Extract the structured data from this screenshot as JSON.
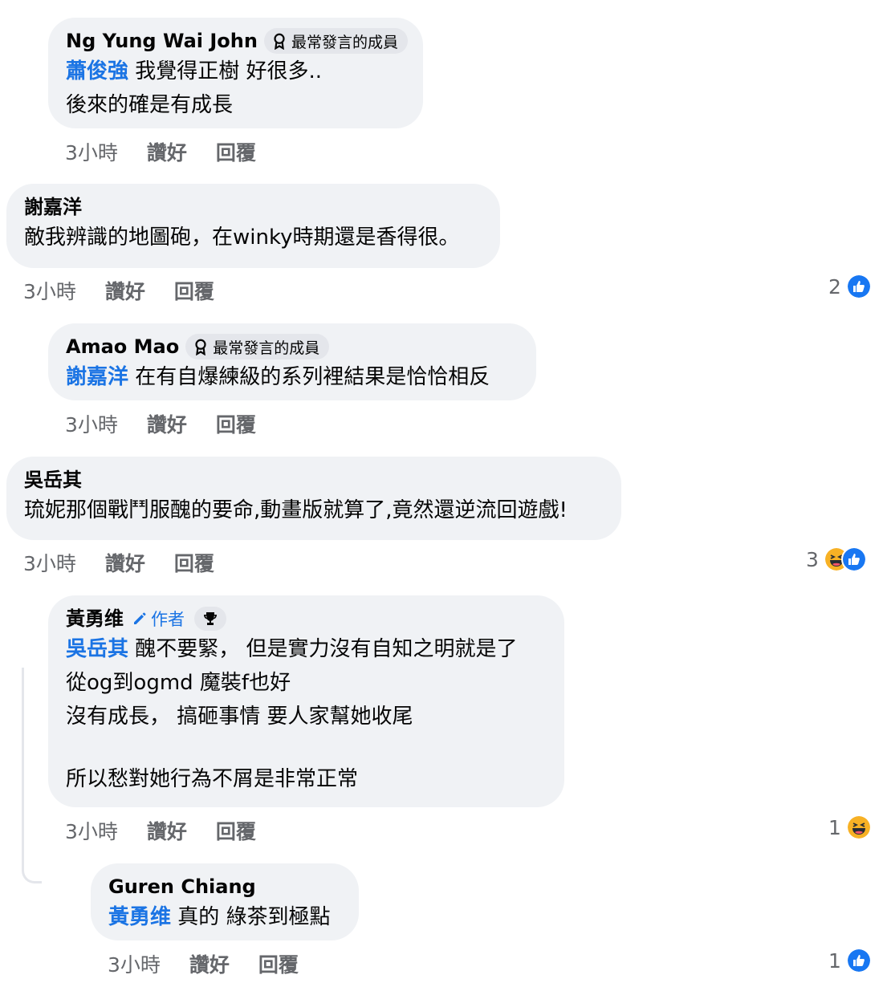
{
  "badge_label": "最常發言的成員",
  "author_label": "作者",
  "comments": [
    {
      "name": "Ng Yung Wai John",
      "mention": "蕭俊強",
      "first_line": " 我覺得正樹 好很多..",
      "lines": [
        "後來的確是有成長"
      ],
      "time": "3小時",
      "like": "讚好",
      "reply": "回覆"
    },
    {
      "name": "謝嘉洋",
      "lines": [
        "敵我辨識的地圖砲，在winky時期還是香得很。"
      ],
      "time": "3小時",
      "like": "讚好",
      "reply": "回覆",
      "reaction_count": "2"
    },
    {
      "name": "Amao Mao",
      "mention": "謝嘉洋",
      "first_line": " 在有自爆練級的系列裡結果是恰恰相反",
      "time": "3小時",
      "like": "讚好",
      "reply": "回覆"
    },
    {
      "name": "吳岳其",
      "lines": [
        "琉妮那個戰鬥服醜的要命,動畫版就算了,竟然還逆流回遊戲!"
      ],
      "time": "3小時",
      "like": "讚好",
      "reply": "回覆",
      "reaction_count": "3"
    },
    {
      "name": "黃勇维",
      "mention": "吳岳其",
      "first_line": " 醜不要緊， 但是實力沒有自知之明就是了",
      "lines": [
        "從og到ogmd 魔裝f也好",
        "沒有成長， 搞砸事情 要人家幫她收尾",
        "",
        "所以愁對她行為不屑是非常正常"
      ],
      "time": "3小時",
      "like": "讚好",
      "reply": "回覆",
      "reaction_count": "1"
    },
    {
      "name": "Guren Chiang",
      "mention": "黃勇维",
      "first_line": " 真的 綠茶到極點",
      "time": "3小時",
      "like": "讚好",
      "reply": "回覆",
      "reaction_count": "1"
    }
  ],
  "colors": {
    "mention": "#1b74e4",
    "bubble": "#f0f2f5",
    "meta": "#65676b",
    "like": "#1877f2",
    "haha": "#f7b125"
  },
  "icons": [
    "top-contributor-icon",
    "pencil-icon",
    "trophy-icon",
    "like-reaction-icon",
    "haha-reaction-icon"
  ]
}
